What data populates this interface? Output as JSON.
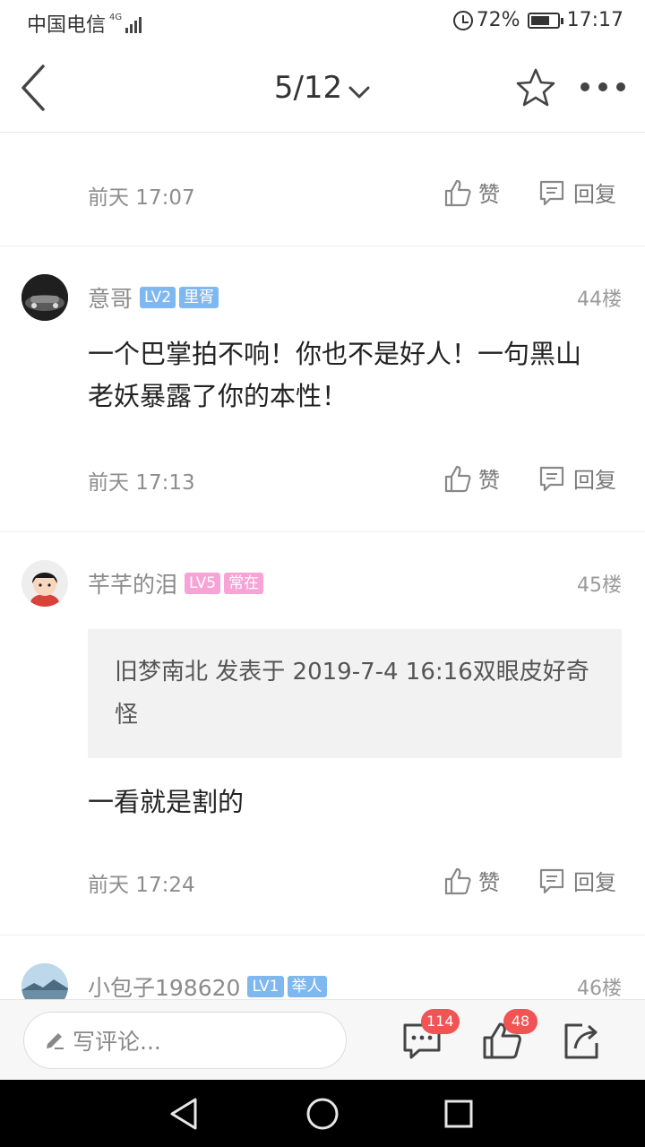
{
  "status_bar": {
    "carrier": "中国电信",
    "network": "4G",
    "battery": "72%",
    "battery_level": 0.72,
    "time": "17:17"
  },
  "nav": {
    "page": "5/12"
  },
  "posts": [
    {
      "time": "前天 17:07",
      "like_label": "赞",
      "reply_label": "回复"
    },
    {
      "username": "意哥",
      "level": "LV2",
      "rank": "里胥",
      "floor": "44楼",
      "text": "一个巴掌拍不响！你也不是好人！一句黑山老妖暴露了你的本性！",
      "time": "前天 17:13",
      "like_label": "赞",
      "reply_label": "回复",
      "badge_color": "#7fb8ef"
    },
    {
      "username": "芊芊的泪",
      "level": "LV5",
      "rank": "常在",
      "floor": "45楼",
      "quote": "旧梦南北 发表于 2019-7-4 16:16双眼皮好奇怪",
      "text": "一看就是割的",
      "time": "前天 17:24",
      "like_label": "赞",
      "reply_label": "回复",
      "badge_color": "#f7a3d6"
    },
    {
      "username": "小包子198620",
      "level": "LV1",
      "rank": "举人",
      "floor": "46楼",
      "badge_color": "#7fb8ef"
    }
  ],
  "bottom_bar": {
    "comment_placeholder": "写评论...",
    "comment_count": "114",
    "like_count": "48"
  },
  "colors": {
    "badge_red": "#f25353",
    "badge_blue": "#7fb8ef",
    "badge_pink": "#f7a3d6"
  }
}
